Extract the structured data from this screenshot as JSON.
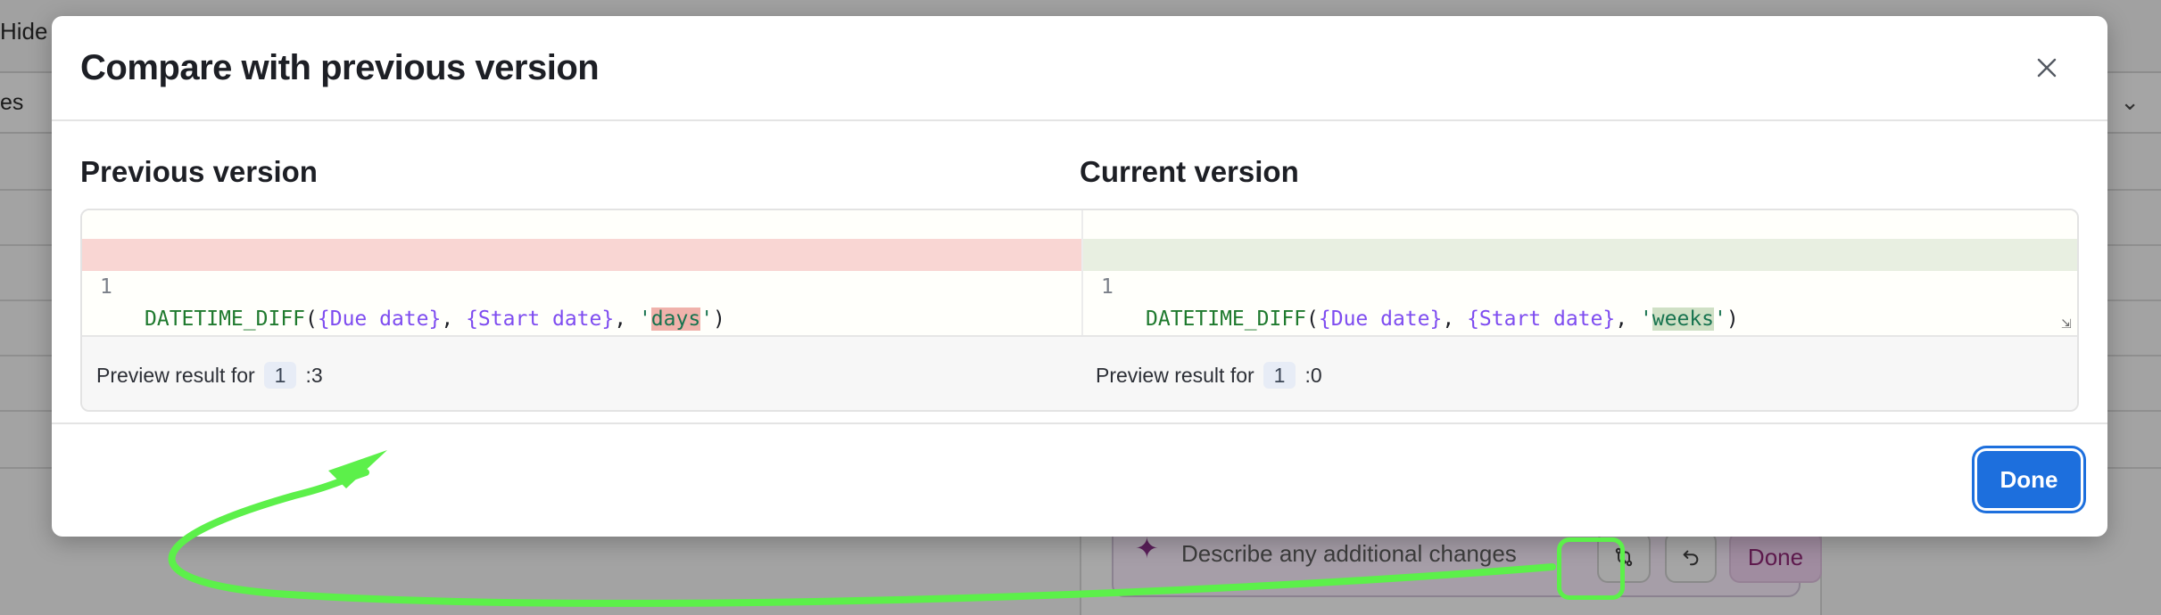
{
  "background": {
    "hide_fields_label": "Hide f",
    "column_label": "es",
    "chevron_icon": "chevron-down-icon",
    "prompt_placeholder": "Describe any additional changes",
    "sparkle_icon": "sparkle-icon",
    "compare_icon": "git-compare-icon",
    "undo_icon": "undo-icon",
    "done_label": "Done"
  },
  "modal": {
    "title": "Compare with previous version",
    "close_icon": "close-icon",
    "previous": {
      "title": "Previous version",
      "line_number": "1",
      "code": {
        "fn": "DATETIME_DIFF",
        "open_paren": "(",
        "field1": "{Due date}",
        "sep1": ", ",
        "field2": "{Start date}",
        "sep2": ", ",
        "quote_open": "'",
        "value": "days",
        "quote_close": "'",
        "close_paren": ")"
      },
      "preview_label": "Preview result for",
      "preview_row": "1",
      "preview_sep": ": ",
      "preview_value": "3"
    },
    "current": {
      "title": "Current version",
      "line_number": "1",
      "code": {
        "fn": "DATETIME_DIFF",
        "open_paren": "(",
        "field1": "{Due date}",
        "sep1": ", ",
        "field2": "{Start date}",
        "sep2": ", ",
        "quote_open": "'",
        "value": "weeks",
        "quote_close": "'",
        "close_paren": ")"
      },
      "preview_label": "Preview result for",
      "preview_row": "1",
      "preview_sep": ": ",
      "preview_value": "0"
    },
    "done_label": "Done"
  },
  "colors": {
    "primary": "#1d6fdd",
    "deleted_line": "#f9d6d3",
    "inserted_line": "#e8efe1",
    "annotation": "#5cf04a",
    "done_ai": "#5f1a4e"
  }
}
